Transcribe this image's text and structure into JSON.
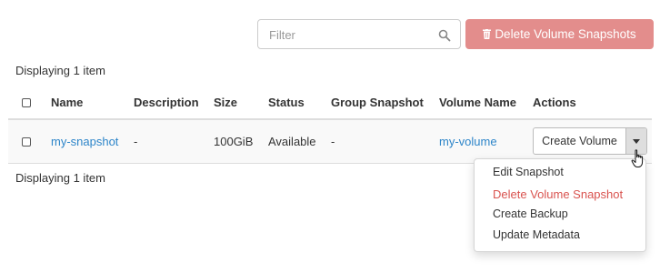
{
  "toolbar": {
    "filter_placeholder": "Filter",
    "delete_button_label": "Delete Volume Snapshots"
  },
  "summary": {
    "top": "Displaying 1 item",
    "bottom": "Displaying 1 item"
  },
  "table": {
    "columns": [
      "Name",
      "Description",
      "Size",
      "Status",
      "Group Snapshot",
      "Volume Name",
      "Actions"
    ],
    "rows": [
      {
        "name": "my-snapshot",
        "description": "-",
        "size": "100GiB",
        "status": "Available",
        "group_snapshot": "-",
        "volume_name": "my-volume",
        "action_label": "Create Volume"
      }
    ]
  },
  "row_menu": {
    "items": [
      "Edit Snapshot",
      "Delete Volume Snapshot",
      "Create Backup",
      "Update Metadata"
    ]
  },
  "colors": {
    "link": "#2d85c9",
    "danger": "#d9534f",
    "danger_button": "#e38d8c"
  },
  "icons": [
    "search-icon",
    "trash-icon",
    "caret-down-icon",
    "hand-pointer-icon"
  ]
}
